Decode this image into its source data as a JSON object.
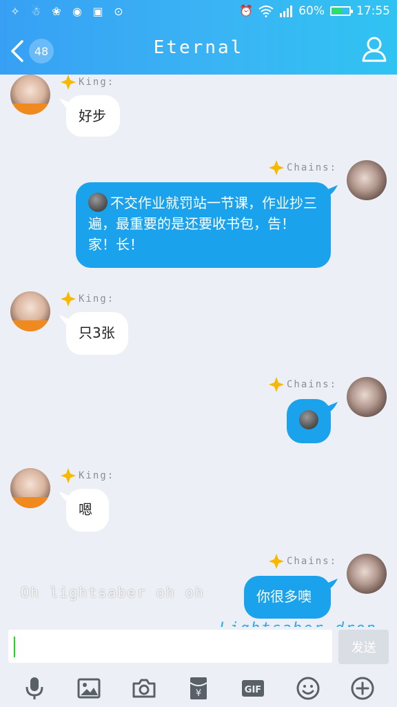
{
  "status_bar": {
    "battery": "60%",
    "battery_level": 0.6,
    "time": "17:55"
  },
  "header": {
    "back_badge": "48",
    "title": "Eternal"
  },
  "messages": [
    {
      "side": "in",
      "sender": "King:",
      "text": "好步"
    },
    {
      "side": "out",
      "sender": "Chains:",
      "text": "不交作业就罚站一节课，作业抄三遍，最重要的是还要收书包，告！家！长！",
      "emoji_prefix": "new-moon-face"
    },
    {
      "side": "in",
      "sender": "King:",
      "text": "只3张"
    },
    {
      "side": "out",
      "sender": "Chains:",
      "text": "",
      "emoji_prefix": "new-moon-face"
    },
    {
      "side": "in",
      "sender": "King:",
      "text": "嗯"
    },
    {
      "side": "out",
      "sender": "Chains:",
      "text": "你很多噢"
    }
  ],
  "overlay": {
    "lyric_line": "Oh lightsaber oh oh",
    "lyric_caption": "Lightsaber drop"
  },
  "input": {
    "value": "",
    "send_label": "发送"
  },
  "toolbar": {
    "items": [
      "mic-icon",
      "image-icon",
      "camera-icon",
      "red-packet-icon",
      "gif-icon",
      "emoji-icon",
      "plus-icon"
    ],
    "gif_label": "GIF",
    "red_packet_label": "¥"
  },
  "colors": {
    "header": "#37a0f4",
    "bubble_out": "#1aa3ec",
    "bubble_in": "#ffffff",
    "background": "#eceff5"
  }
}
